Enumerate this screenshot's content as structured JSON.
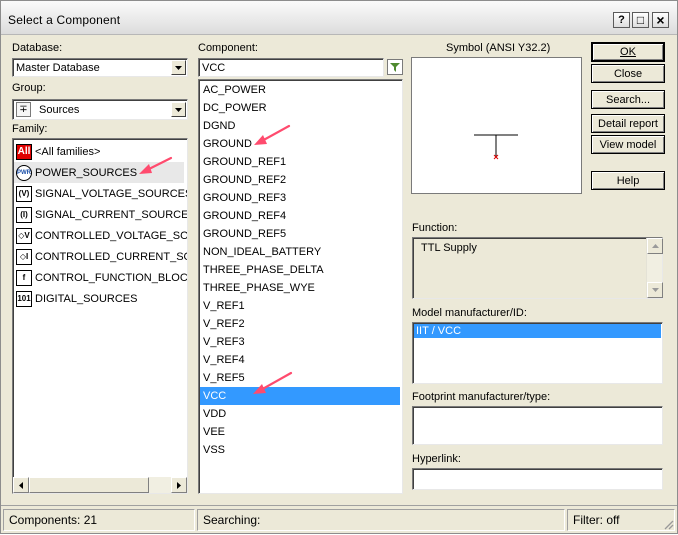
{
  "window": {
    "title": "Select a Component",
    "controls": {
      "help": "?",
      "minimize": "_",
      "maximize": "□",
      "close": "×"
    }
  },
  "database": {
    "label": "Database:",
    "value": "Master Database"
  },
  "group": {
    "label": "Group:",
    "value": "Sources",
    "icon": "sources-icon"
  },
  "family": {
    "label": "Family:",
    "items": [
      {
        "icon_text": "All",
        "label": "<All families>",
        "icon": "all-families-icon"
      },
      {
        "icon_text": "PWR",
        "label": "POWER_SOURCES",
        "icon": "power-sources-icon"
      },
      {
        "icon_text": "(V)",
        "label": "SIGNAL_VOLTAGE_SOURCES",
        "icon": "signal-voltage-icon"
      },
      {
        "icon_text": "(I)",
        "label": "SIGNAL_CURRENT_SOURCES",
        "icon": "signal-current-icon"
      },
      {
        "icon_text": "◇V",
        "label": "CONTROLLED_VOLTAGE_SOUR",
        "icon": "controlled-voltage-icon"
      },
      {
        "icon_text": "◇I",
        "label": "CONTROLLED_CURRENT_SOU",
        "icon": "controlled-current-icon"
      },
      {
        "icon_text": "f",
        "label": "CONTROL_FUNCTION_BLOCKS",
        "icon": "control-function-icon"
      },
      {
        "icon_text": "101",
        "label": "DIGITAL_SOURCES",
        "icon": "digital-sources-icon"
      }
    ]
  },
  "component": {
    "label": "Component:",
    "search_value": "VCC",
    "filter_icon": "filter-icon",
    "items": [
      "AC_POWER",
      "DC_POWER",
      "DGND",
      "GROUND",
      "GROUND_REF1",
      "GROUND_REF2",
      "GROUND_REF3",
      "GROUND_REF4",
      "GROUND_REF5",
      "NON_IDEAL_BATTERY",
      "THREE_PHASE_DELTA",
      "THREE_PHASE_WYE",
      "V_REF1",
      "V_REF2",
      "V_REF3",
      "V_REF4",
      "V_REF5",
      "VCC",
      "VDD",
      "VEE",
      "VSS"
    ],
    "selected_index": 17
  },
  "symbol": {
    "label": "Symbol (ANSI Y32.2)"
  },
  "function": {
    "label": "Function:",
    "value": "TTL Supply"
  },
  "model": {
    "label": "Model manufacturer/ID:",
    "items": [
      "IIT / VCC"
    ]
  },
  "footprint": {
    "label": "Footprint manufacturer/type:"
  },
  "hyperlink": {
    "label": "Hyperlink:"
  },
  "buttons": {
    "ok": "OK",
    "close": "Close",
    "search": "Search...",
    "detail_report": "Detail report",
    "view_model": "View model",
    "help": "Help"
  },
  "status": {
    "components": "Components: 21",
    "searching": "Searching:",
    "filter": "Filter: off"
  },
  "colors": {
    "selection": "#3399ff",
    "annotation_arrow": "#ff4b6e"
  }
}
